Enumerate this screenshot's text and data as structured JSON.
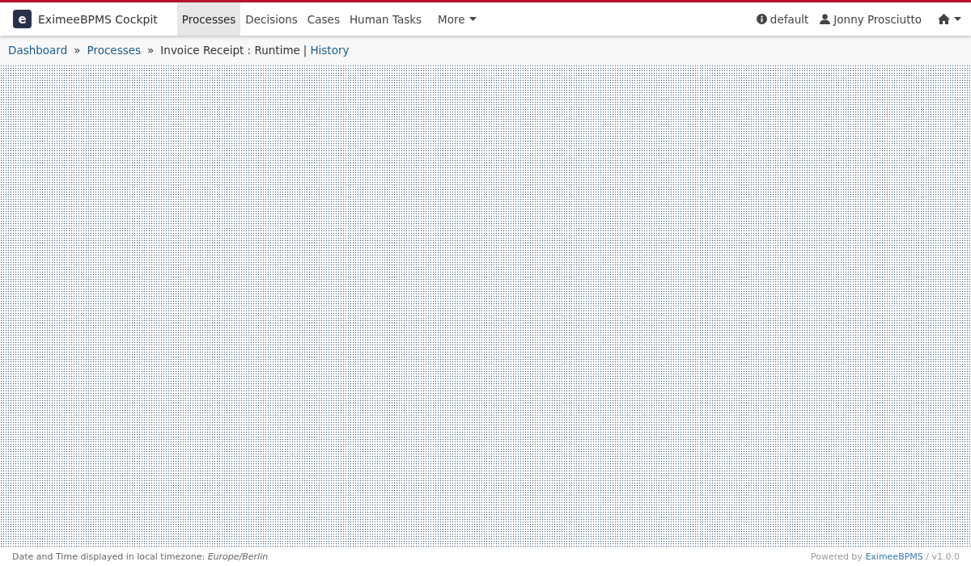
{
  "navbar": {
    "brand": "EximeeBPMS Cockpit",
    "logo_letter": "e",
    "items": [
      {
        "label": "Processes",
        "selected": true,
        "kind": "link"
      },
      {
        "label": "Decisions",
        "selected": false,
        "kind": "link"
      },
      {
        "label": "Cases",
        "selected": false,
        "kind": "link"
      },
      {
        "label": "Human Tasks",
        "selected": false,
        "kind": "link"
      },
      {
        "label": "More",
        "selected": false,
        "kind": "dropdown"
      }
    ],
    "engine": "default",
    "user": "Jonny Prosciutto"
  },
  "breadcrumb": [
    {
      "kind": "link",
      "text": "Dashboard"
    },
    {
      "kind": "separator",
      "text": "»"
    },
    {
      "kind": "link",
      "text": "Processes"
    },
    {
      "kind": "separator",
      "text": "»"
    },
    {
      "kind": "current",
      "text": "Invoice Receipt : Runtime"
    },
    {
      "kind": "separator",
      "text": "|"
    },
    {
      "kind": "link",
      "text": "History"
    }
  ],
  "footer": {
    "timezone_note": "Date and Time displayed in local timezone: *Europe/Berlin*",
    "powered_prefix": "Powered by",
    "powered_link": "EximeeBPMS",
    "version": "/ v1.0.0"
  }
}
